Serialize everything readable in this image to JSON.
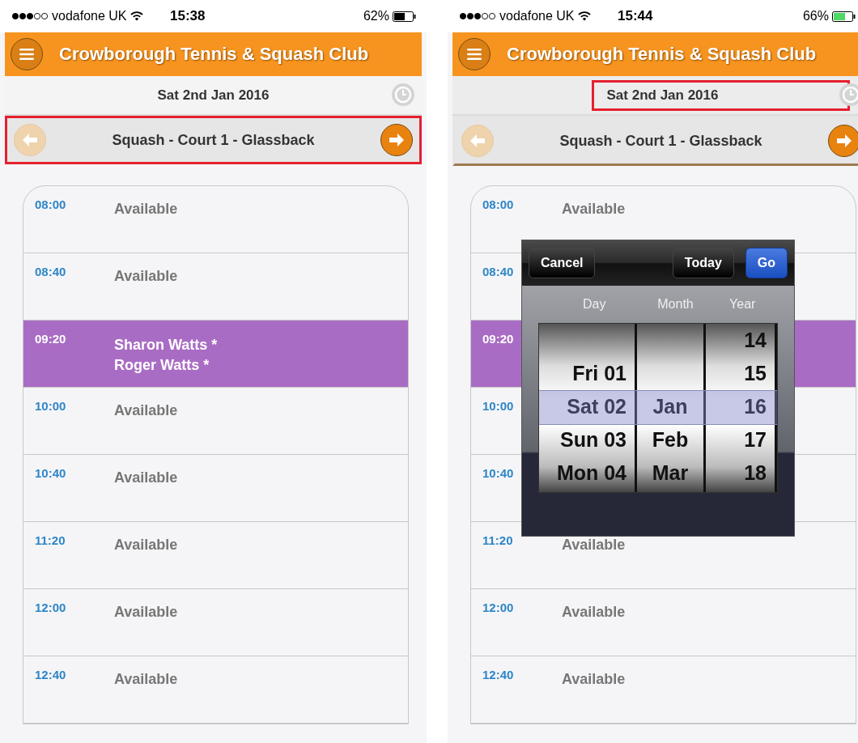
{
  "phones": [
    {
      "status_bar": {
        "carrier": "vodafone UK",
        "time": "15:38",
        "battery": "62%",
        "charging": false
      },
      "header": {
        "title": "Crowborough Tennis & Squash Club"
      },
      "date_bar": {
        "date": "Sat 2nd Jan 2016",
        "highlighted": false
      },
      "court_bar": {
        "court": "Squash - Court 1 - Glassback",
        "highlighted": true,
        "prev_disabled": true
      },
      "slots": [
        {
          "time": "08:00",
          "kind": "available",
          "status": "Available"
        },
        {
          "time": "08:40",
          "kind": "available",
          "status": "Available"
        },
        {
          "time": "09:20",
          "kind": "booked",
          "players": [
            "Sharon Watts *",
            "Roger Watts *"
          ]
        },
        {
          "time": "10:00",
          "kind": "available",
          "status": "Available"
        },
        {
          "time": "10:40",
          "kind": "available",
          "status": "Available"
        },
        {
          "time": "11:20",
          "kind": "available",
          "status": "Available"
        },
        {
          "time": "12:00",
          "kind": "available",
          "status": "Available"
        },
        {
          "time": "12:40",
          "kind": "available",
          "status": "Available"
        }
      ]
    },
    {
      "status_bar": {
        "carrier": "vodafone UK",
        "time": "15:44",
        "battery": "66%",
        "charging": true
      },
      "header": {
        "title": "Crowborough Tennis & Squash Club"
      },
      "date_bar": {
        "date": "Sat 2nd Jan 2016",
        "highlighted": true
      },
      "court_bar": {
        "court": "Squash - Court 1 - Glassback",
        "highlighted": false,
        "prev_disabled": true
      },
      "slots": [
        {
          "time": "08:00",
          "kind": "available",
          "status": "Available"
        },
        {
          "time": "08:40",
          "kind": "available"
        },
        {
          "time": "09:20",
          "kind": "booked"
        },
        {
          "time": "10:00",
          "kind": "available"
        },
        {
          "time": "10:40",
          "kind": "available"
        },
        {
          "time": "11:20",
          "kind": "available",
          "status": "Available"
        },
        {
          "time": "12:00",
          "kind": "available",
          "status": "Available"
        },
        {
          "time": "12:40",
          "kind": "available",
          "status": "Available"
        }
      ],
      "date_picker": {
        "buttons": [
          {
            "label": "Cancel",
            "kind": "plain"
          },
          {
            "label": "Today",
            "kind": "plain"
          },
          {
            "label": "Go",
            "kind": "primary"
          }
        ],
        "columns": [
          {
            "label": "Day",
            "items": [
              {
                "text": "Fri 01",
                "selected": false
              },
              {
                "text": "Sat 02",
                "selected": true
              },
              {
                "text": "Sun 03",
                "selected": false
              },
              {
                "text": "Mon 04",
                "selected": false
              }
            ]
          },
          {
            "label": "Month",
            "items": [
              {
                "text": "Jan",
                "selected": true
              },
              {
                "text": "Feb",
                "selected": false
              },
              {
                "text": "Mar",
                "selected": false
              }
            ]
          },
          {
            "label": "Year",
            "items": [
              {
                "text": "14",
                "selected": false
              },
              {
                "text": "15",
                "selected": false
              },
              {
                "text": "16",
                "selected": true
              },
              {
                "text": "17",
                "selected": false
              },
              {
                "text": "18",
                "selected": false
              }
            ]
          }
        ]
      }
    }
  ]
}
